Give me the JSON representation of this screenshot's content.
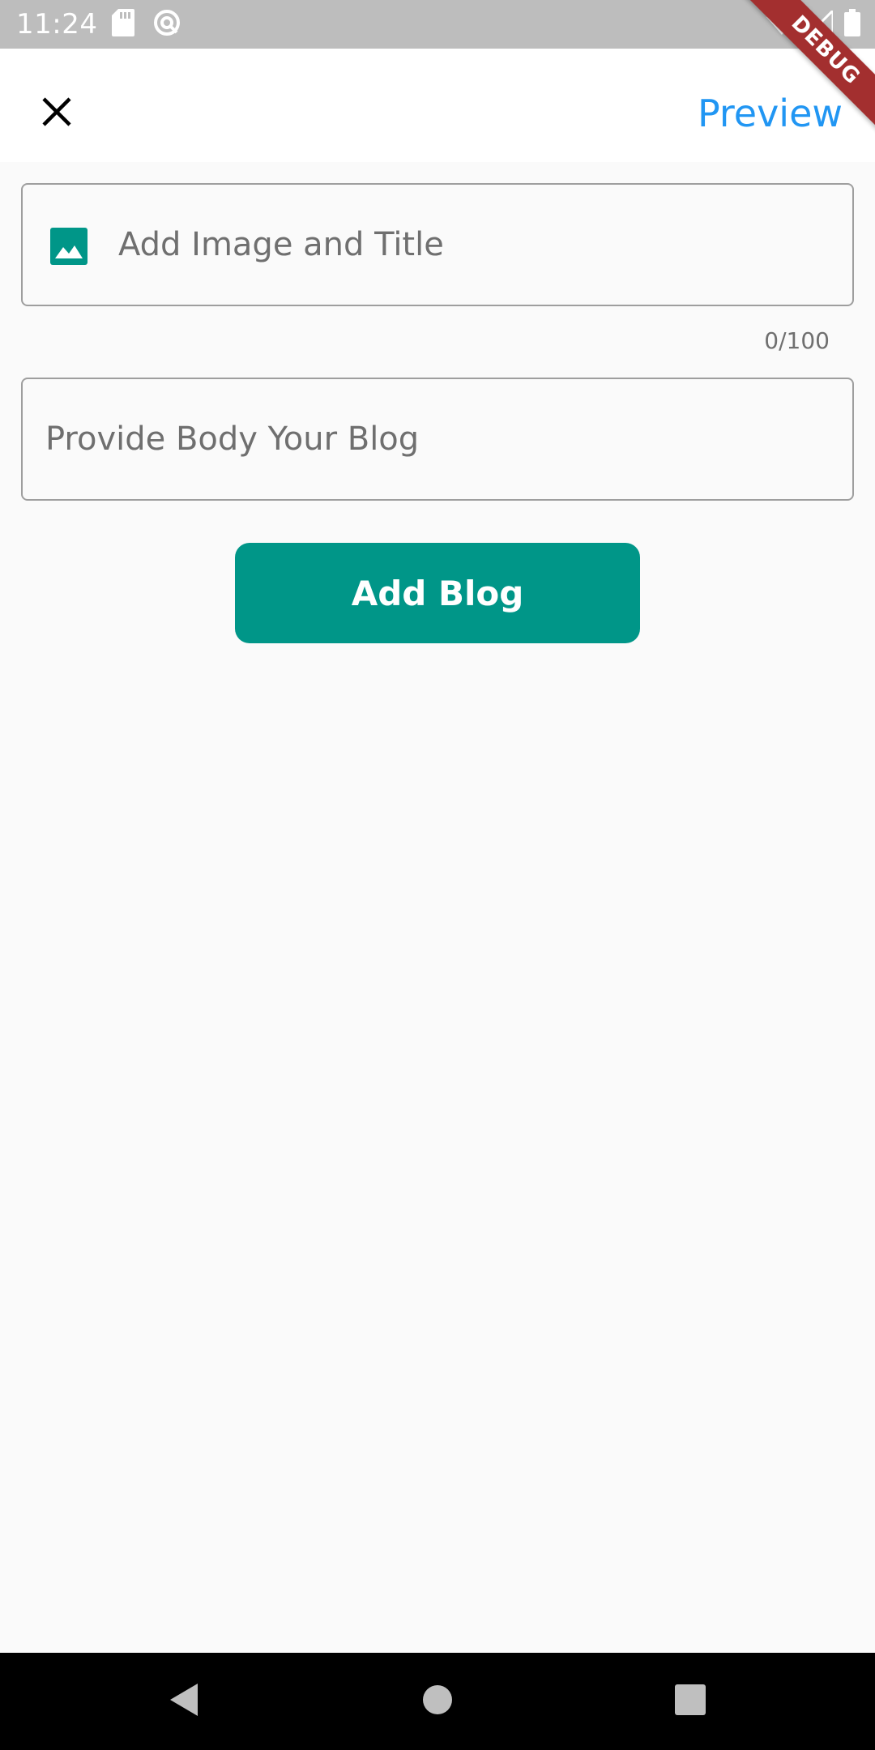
{
  "status_bar": {
    "time": "11:24",
    "icons": [
      "sd-card-icon",
      "data-saver-icon",
      "wifi-icon",
      "signal-icon",
      "battery-icon"
    ]
  },
  "debug_banner": {
    "label": "DEBUG",
    "color": "#a32f2f"
  },
  "app_bar": {
    "close_icon": "close-icon",
    "preview_label": "Preview",
    "preview_color": "#2196f3"
  },
  "form": {
    "title_field": {
      "icon": "image-icon",
      "placeholder": "Add Image and Title",
      "value": "",
      "counter": "0/100"
    },
    "body_field": {
      "placeholder": "Provide Body Your Blog",
      "value": ""
    },
    "submit_label": "Add Blog",
    "accent_color": "#009688"
  },
  "nav_bar": {
    "buttons": [
      "back-icon",
      "home-icon",
      "recents-icon"
    ]
  }
}
